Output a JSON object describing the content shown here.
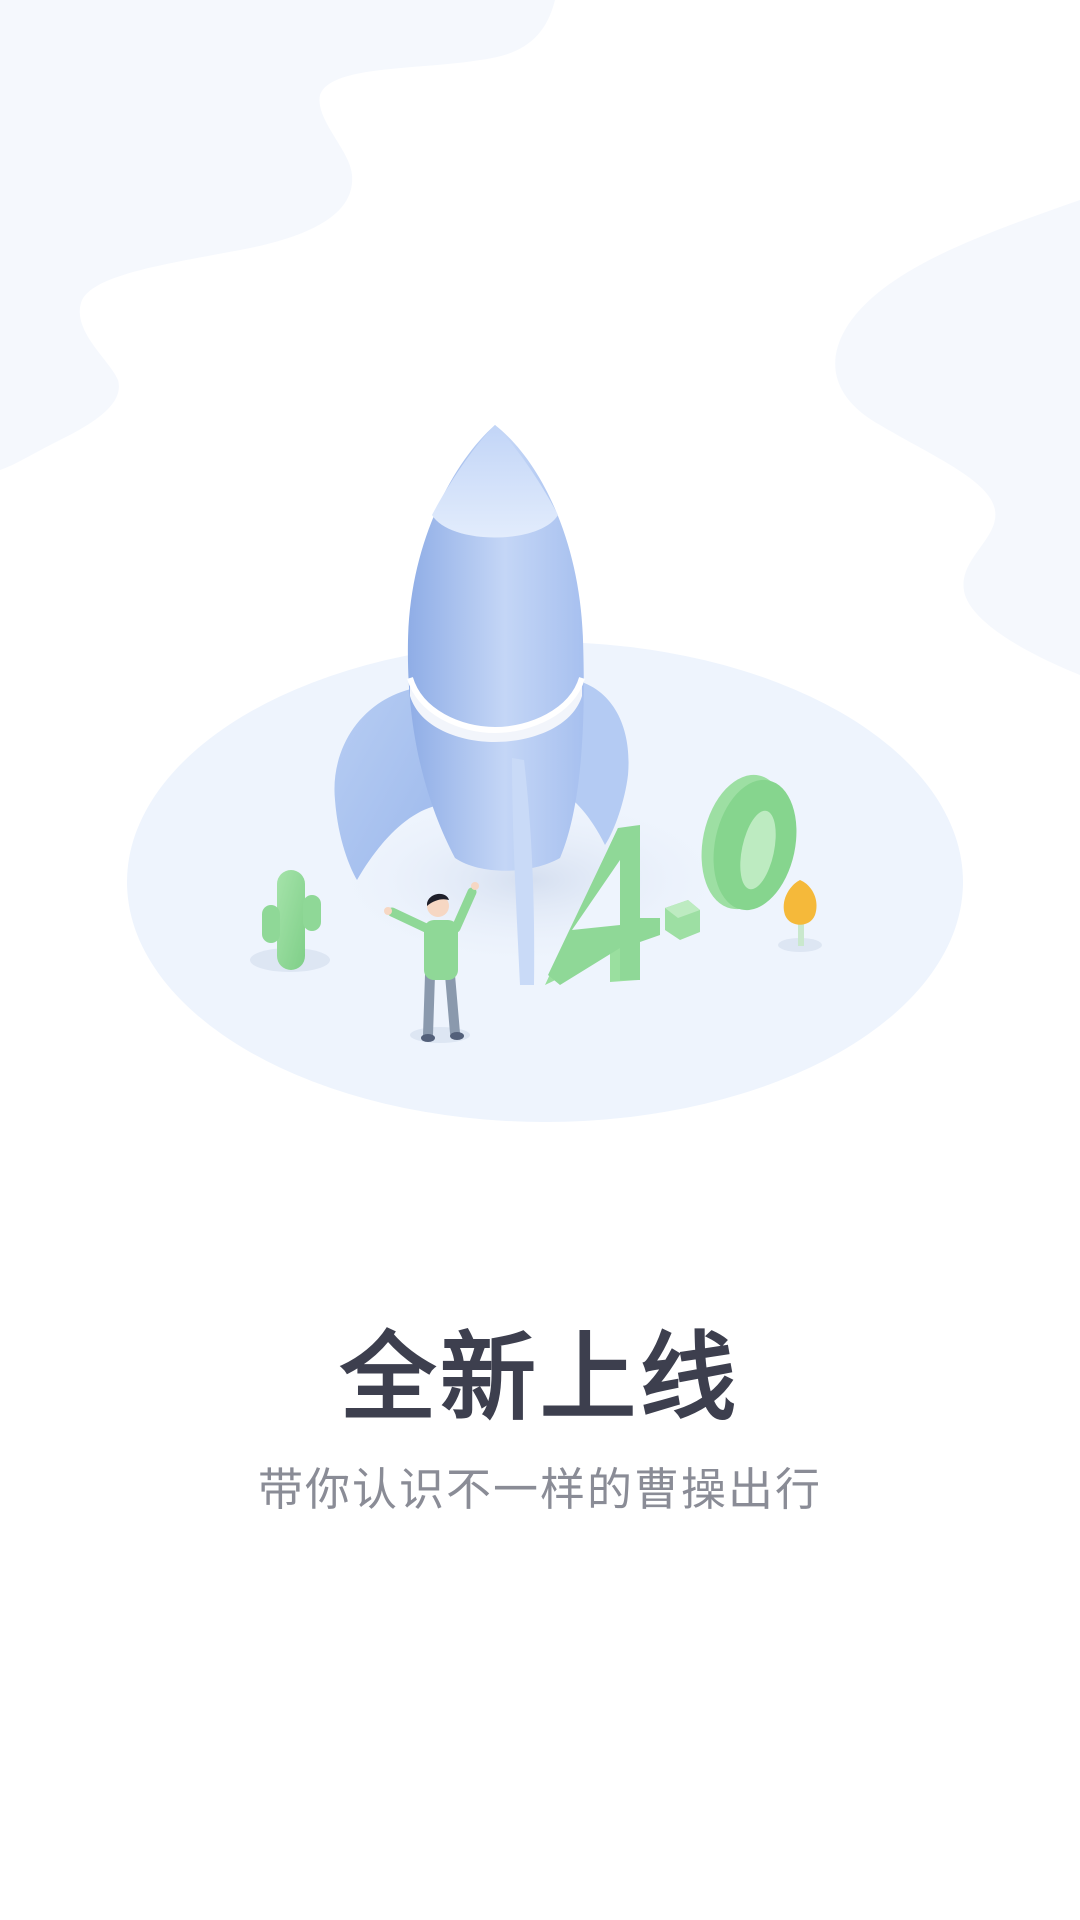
{
  "intro": {
    "title": "全新上线",
    "subtitle": "带你认识不一样的曹操出行",
    "version_badge": "4.0"
  },
  "illustration": {
    "name": "rocket-launch-illustration",
    "colors": {
      "blob": "#f5f8fd",
      "platform": "#eef4fd",
      "rocket": "#a9c3f0",
      "rocket_light": "#d6e4fb",
      "green": "#86d58e",
      "green_dark": "#6fc57a",
      "yellow": "#f5b93a"
    }
  }
}
